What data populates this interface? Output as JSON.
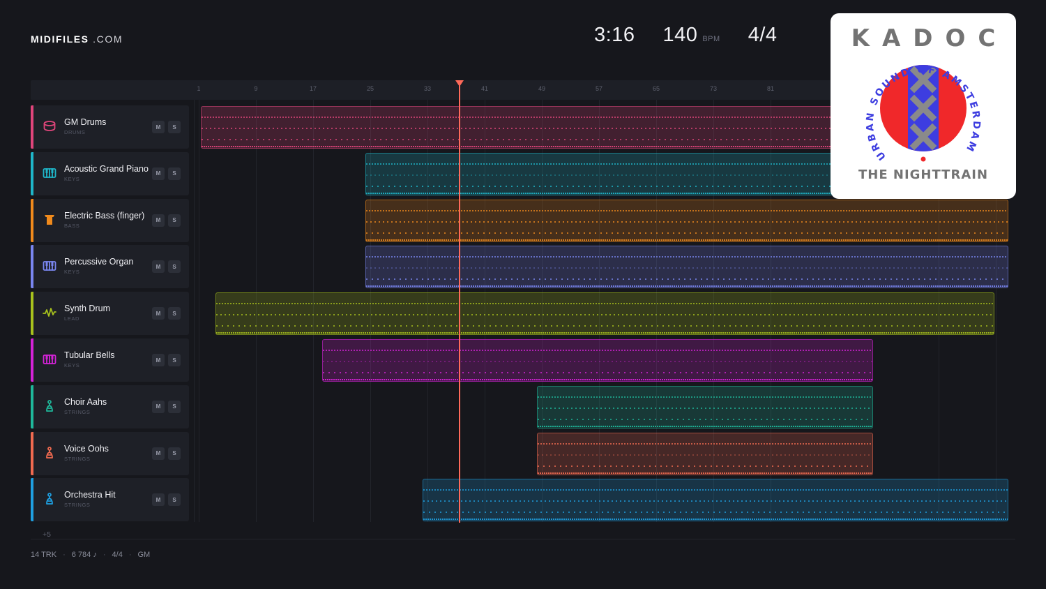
{
  "brand": {
    "bold": "MIDIFILES",
    "light": ".COM"
  },
  "transport": {
    "time": "3:16",
    "bpm": "140",
    "bpm_unit": "BPM",
    "signature": "4/4"
  },
  "ruler": [
    "1",
    "9",
    "17",
    "25",
    "33",
    "41",
    "49",
    "57",
    "65",
    "73",
    "81"
  ],
  "playhead_bar": 37.5,
  "tracks": [
    {
      "name": "GM Drums",
      "category": "DRUMS",
      "color": "#e0457b",
      "icon": "drum-icon",
      "mute": "M",
      "solo": "S",
      "clip": {
        "start": 1,
        "end": 110
      }
    },
    {
      "name": "Acoustic Grand Piano",
      "category": "KEYS",
      "color": "#1fb6c9",
      "icon": "piano-icon",
      "mute": "M",
      "solo": "S",
      "clip": {
        "start": 24,
        "end": 110
      }
    },
    {
      "name": "Electric Bass (finger)",
      "category": "BASS",
      "color": "#f08a1c",
      "icon": "bass-icon",
      "mute": "M",
      "solo": "S",
      "clip": {
        "start": 24,
        "end": 114
      }
    },
    {
      "name": "Percussive Organ",
      "category": "KEYS",
      "color": "#7a86f0",
      "icon": "organ-icon",
      "mute": "M",
      "solo": "S",
      "clip": {
        "start": 24,
        "end": 114
      }
    },
    {
      "name": "Synth Drum",
      "category": "LEAD",
      "color": "#a8c21d",
      "icon": "wave-icon",
      "mute": "M",
      "solo": "S",
      "clip": {
        "start": 3,
        "end": 112
      }
    },
    {
      "name": "Tubular Bells",
      "category": "KEYS",
      "color": "#d523d8",
      "icon": "bells-icon",
      "mute": "M",
      "solo": "S",
      "clip": {
        "start": 18,
        "end": 95
      }
    },
    {
      "name": "Choir Aahs",
      "category": "STRINGS",
      "color": "#1fb89b",
      "icon": "choir-icon",
      "mute": "M",
      "solo": "S",
      "clip": {
        "start": 48,
        "end": 95
      }
    },
    {
      "name": "Voice Oohs",
      "category": "STRINGS",
      "color": "#f06a50",
      "icon": "voice-icon",
      "mute": "M",
      "solo": "S",
      "clip": {
        "start": 48,
        "end": 95
      }
    },
    {
      "name": "Orchestra Hit",
      "category": "STRINGS",
      "color": "#1f9fe0",
      "icon": "orchestra-icon",
      "mute": "M",
      "solo": "S",
      "clip": {
        "start": 32,
        "end": 114
      }
    }
  ],
  "more_tracks": "+5",
  "footer": {
    "tracks": "14 TRK",
    "notes": "6 784 ♪",
    "signature": "4/4",
    "standard": "GM"
  },
  "logo": {
    "title": "KADOC",
    "ring_text": "URBAN SOUND OF AMSTERDAM",
    "subtitle": "THE NIGHTTRAIN",
    "colors": {
      "ring": "#3d3de0",
      "disc": "#f0282a",
      "band": "#3d3de0",
      "cross": "#8a8a8a"
    }
  }
}
